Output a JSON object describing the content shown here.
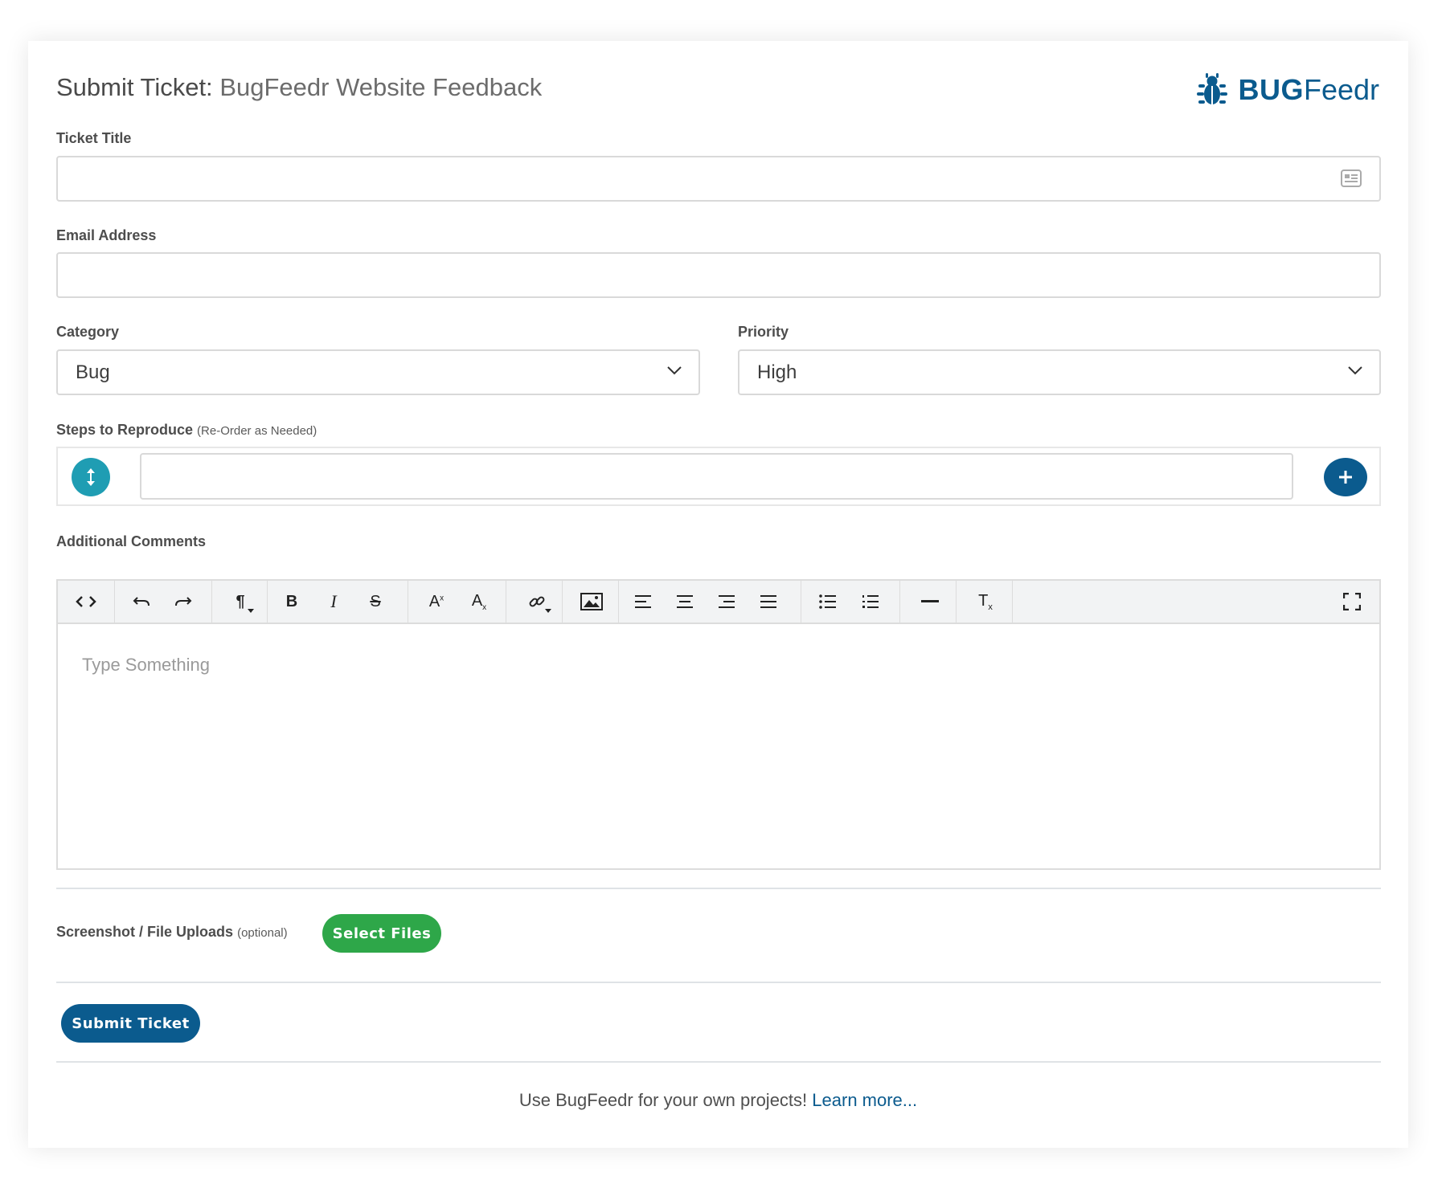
{
  "header": {
    "title_prefix": "Submit Ticket:",
    "title_project": "BugFeedr Website Feedback",
    "logo_bold": "BUG",
    "logo_light": "Feedr"
  },
  "form": {
    "ticket_title": {
      "label": "Ticket Title",
      "value": "",
      "placeholder": ""
    },
    "email": {
      "label": "Email Address",
      "value": "",
      "placeholder": ""
    },
    "category": {
      "label": "Category",
      "selected": "Bug"
    },
    "priority": {
      "label": "Priority",
      "selected": "High"
    },
    "steps": {
      "label": "Steps to Reproduce",
      "hint": "(Re-Order as Needed)",
      "value": ""
    },
    "comments": {
      "label": "Additional Comments",
      "placeholder": "Type Something",
      "toolbar": [
        "code-view",
        "undo",
        "redo",
        "paragraph-format",
        "bold",
        "italic",
        "strikethrough",
        "superscript",
        "subscript",
        "insert-link",
        "insert-image",
        "align-left",
        "align-center",
        "align-right",
        "align-justify",
        "unordered-list",
        "ordered-list",
        "horizontal-line",
        "clear-formatting",
        "fullscreen"
      ]
    },
    "uploads": {
      "label": "Screenshot / File Uploads",
      "hint": "(optional)",
      "button": "Select Files"
    },
    "submit": "Submit Ticket"
  },
  "footer": {
    "text": "Use BugFeedr for your own projects!",
    "link": "Learn more..."
  },
  "colors": {
    "brand": "#0b5b8e",
    "teal": "#1f9db3",
    "green": "#2ea749"
  }
}
